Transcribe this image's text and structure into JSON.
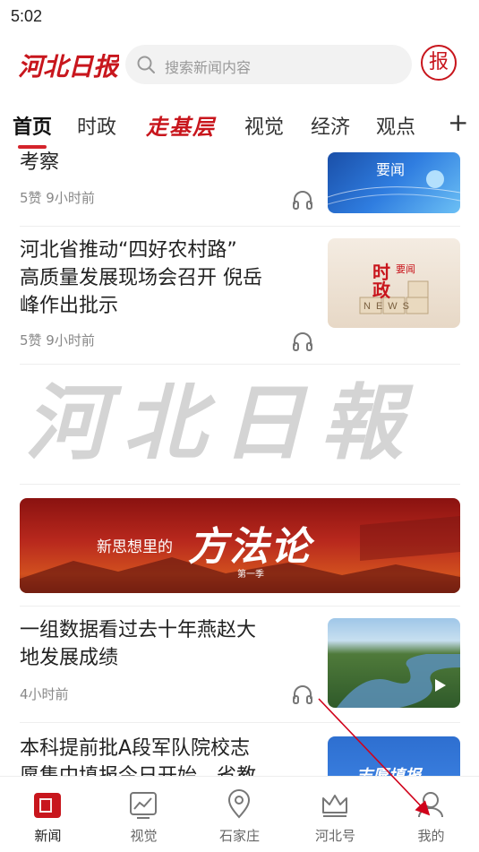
{
  "status_bar": {
    "time": "5:02"
  },
  "header": {
    "logo_text": "河北日报",
    "search_placeholder": "搜索新闻内容",
    "paper_badge": "报"
  },
  "tabs": [
    {
      "label": "首页",
      "active": true
    },
    {
      "label": "时政",
      "active": false
    },
    {
      "label": "走基层",
      "active": false
    },
    {
      "label": "视觉",
      "active": false
    },
    {
      "label": "经济",
      "active": false
    },
    {
      "label": "观点",
      "active": false
    }
  ],
  "tab_more": "+",
  "feed": {
    "items": [
      {
        "title": "考察",
        "meta": "5赞  9小时前",
        "thumb_label": "要闻"
      },
      {
        "title_lines": [
          "河北省推动“四好农村路”",
          "高质量发展现场会召开 倪岳",
          "峰作出批示"
        ],
        "meta": "5赞  9小时前",
        "thumb_label_a": "时",
        "thumb_label_b": "政",
        "thumb_label_c": "要闻",
        "thumb_label_d": "NEWS"
      },
      {
        "watermark_text": "河北日報"
      },
      {
        "banner_small": "新思想里的",
        "banner_big": "方法论",
        "banner_season": "第一季"
      },
      {
        "title_lines": [
          "一组数据看过去十年燕赵大",
          "地发展成绩"
        ],
        "meta": "4小时前"
      },
      {
        "title_lines": [
          "本科提前批A段军队院校志",
          "愿集中填报今日开始，省教"
        ],
        "thumb_label": "志愿填报"
      }
    ]
  },
  "bottom_nav": [
    {
      "label": "新闻",
      "icon": "news-icon",
      "active": true
    },
    {
      "label": "视觉",
      "icon": "chart-icon",
      "active": false
    },
    {
      "label": "石家庄",
      "icon": "location-icon",
      "active": false
    },
    {
      "label": "河北号",
      "icon": "crown-icon",
      "active": false
    },
    {
      "label": "我的",
      "icon": "person-icon",
      "active": false
    }
  ],
  "colors": {
    "brand_red": "#c8161d",
    "tab_underline": "#d4232b",
    "annotation_arrow": "#d0021b"
  }
}
